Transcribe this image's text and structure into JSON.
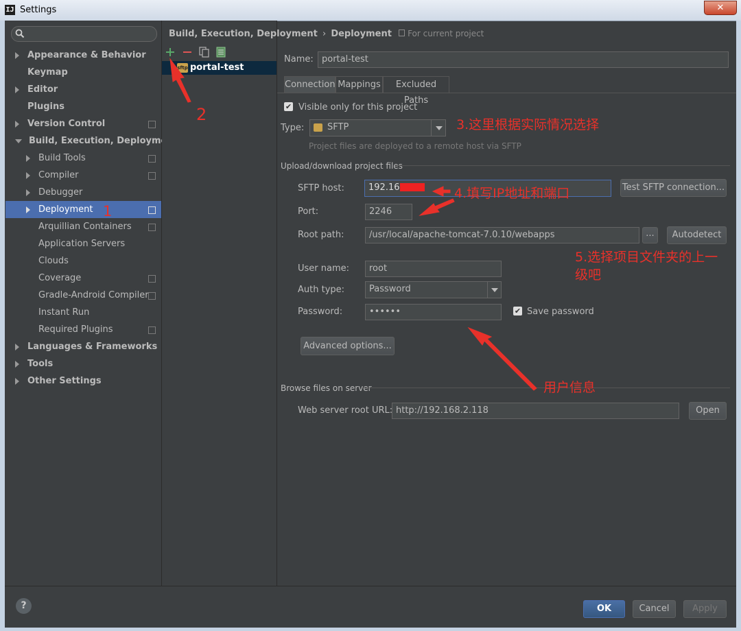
{
  "window": {
    "title": "Settings",
    "app_icon": "IJ"
  },
  "sidebar": {
    "search_placeholder": "",
    "items": [
      {
        "label": "Appearance & Behavior"
      },
      {
        "label": "Keymap"
      },
      {
        "label": "Editor"
      },
      {
        "label": "Plugins"
      },
      {
        "label": "Version Control"
      },
      {
        "label": "Build, Execution, Deployment"
      },
      {
        "label": "Build Tools"
      },
      {
        "label": "Compiler"
      },
      {
        "label": "Debugger"
      },
      {
        "label": "Deployment"
      },
      {
        "label": "Arquillian Containers"
      },
      {
        "label": "Application Servers"
      },
      {
        "label": "Clouds"
      },
      {
        "label": "Coverage"
      },
      {
        "label": "Gradle-Android Compiler"
      },
      {
        "label": "Instant Run"
      },
      {
        "label": "Required Plugins"
      },
      {
        "label": "Languages & Frameworks"
      },
      {
        "label": "Tools"
      },
      {
        "label": "Other Settings"
      }
    ]
  },
  "breadcrumb": {
    "part1": "Build, Execution, Deployment",
    "sep": "›",
    "part2": "Deployment",
    "scope": "For current project"
  },
  "servers": {
    "items": [
      "portal-test"
    ],
    "item_icon": "sftp"
  },
  "form": {
    "name_label": "Name:",
    "name_value": "portal-test",
    "tabs": [
      "Connection",
      "Mappings",
      "Excluded Paths"
    ],
    "visible_only_label": "Visible only for this project",
    "type_label": "Type:",
    "type_value": "SFTP",
    "type_hint": "Project files are deployed to a remote host via SFTP",
    "upload_section": "Upload/download project files",
    "sftp_host_label": "SFTP host:",
    "sftp_host_value": "192.168.",
    "test_button": "Test SFTP connection...",
    "port_label": "Port:",
    "port_value": "2246",
    "root_path_label": "Root path:",
    "root_path_value": "/usr/local/apache-tomcat-7.0.10/webapps",
    "browse_button": "...",
    "autodetect_button": "Autodetect",
    "user_name_label": "User name:",
    "user_name_value": "root",
    "auth_type_label": "Auth type:",
    "auth_type_value": "Password",
    "password_label": "Password:",
    "password_value": "••••••",
    "save_password_label": "Save password",
    "advanced_button": "Advanced options...",
    "browse_section": "Browse files on server",
    "web_root_label": "Web server root URL:",
    "web_root_value": "http://192.168.2.118",
    "open_button": "Open"
  },
  "footer": {
    "help": "?",
    "ok": "OK",
    "cancel": "Cancel",
    "apply": "Apply"
  },
  "annotations": {
    "a1": "1",
    "a2": "2",
    "a3": "3.这里根据实际情况选择",
    "a4": "4.填写IP地址和端口",
    "a5": "5.选择项目文件夹的上一级吧",
    "a5_line1": "5.选择项目文件夹的上一",
    "a5_line2": "级吧",
    "a6": "用户信息",
    "color": "#e8312a"
  }
}
